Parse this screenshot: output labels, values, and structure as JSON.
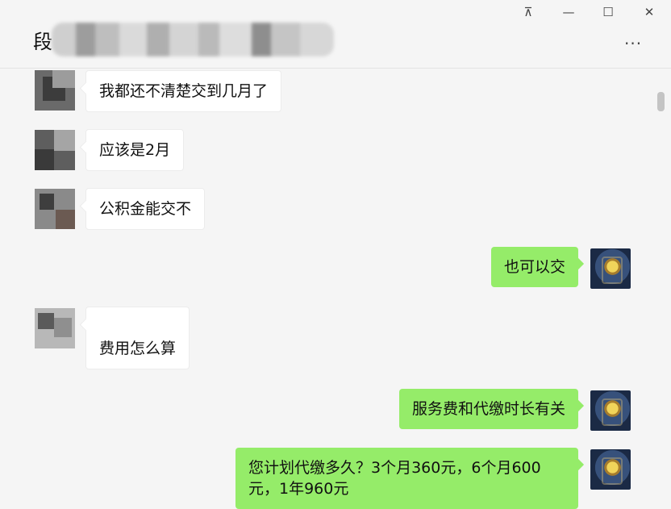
{
  "window": {
    "title_visible_char": "段",
    "controls": {
      "pin": "⊼",
      "minimize": "—",
      "maximize": "☐",
      "close": "✕"
    },
    "more_icon": "···"
  },
  "messages": [
    {
      "side": "in",
      "text": "我都还不清楚交到几月了"
    },
    {
      "side": "in",
      "text": "应该是2月"
    },
    {
      "side": "in",
      "text": "公积金能交不"
    },
    {
      "side": "out",
      "text": "也可以交"
    },
    {
      "side": "in",
      "text": "费用怎么算"
    },
    {
      "side": "out",
      "text": "服务费和代缴时长有关"
    },
    {
      "side": "out",
      "text": "您计划代缴多久？3个月360元，6个月600元，1年960元"
    }
  ],
  "colors": {
    "outgoing_bubble": "#95ec69",
    "incoming_bubble": "#ffffff",
    "background": "#f5f5f5"
  }
}
